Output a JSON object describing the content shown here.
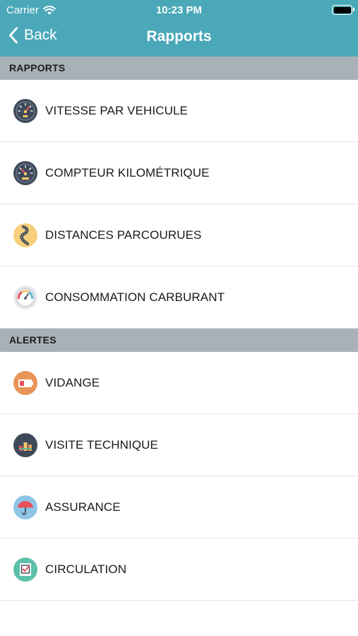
{
  "status_bar": {
    "carrier": "Carrier",
    "time": "10:23 PM"
  },
  "nav": {
    "back_label": "Back",
    "title": "Rapports"
  },
  "sections": [
    {
      "header": "RAPPORTS",
      "items": [
        {
          "label": "VITESSE PAR VEHICULE",
          "icon": "speedometer-icon"
        },
        {
          "label": "COMPTEUR KILOMÉTRIQUE",
          "icon": "odometer-icon"
        },
        {
          "label": "DISTANCES PARCOURUES",
          "icon": "winding-road-icon"
        },
        {
          "label": "CONSOMMATION CARBURANT",
          "icon": "fuel-gauge-icon"
        }
      ]
    },
    {
      "header": "ALERTES",
      "items": [
        {
          "label": "VIDANGE",
          "icon": "oil-battery-icon"
        },
        {
          "label": "VISITE TECHNIQUE",
          "icon": "inspection-icon"
        },
        {
          "label": "ASSURANCE",
          "icon": "umbrella-icon"
        },
        {
          "label": "CIRCULATION",
          "icon": "checklist-icon"
        }
      ]
    }
  ],
  "colors": {
    "nav_bar": "#4aa8b8",
    "section_header": "#a9b1b8"
  }
}
